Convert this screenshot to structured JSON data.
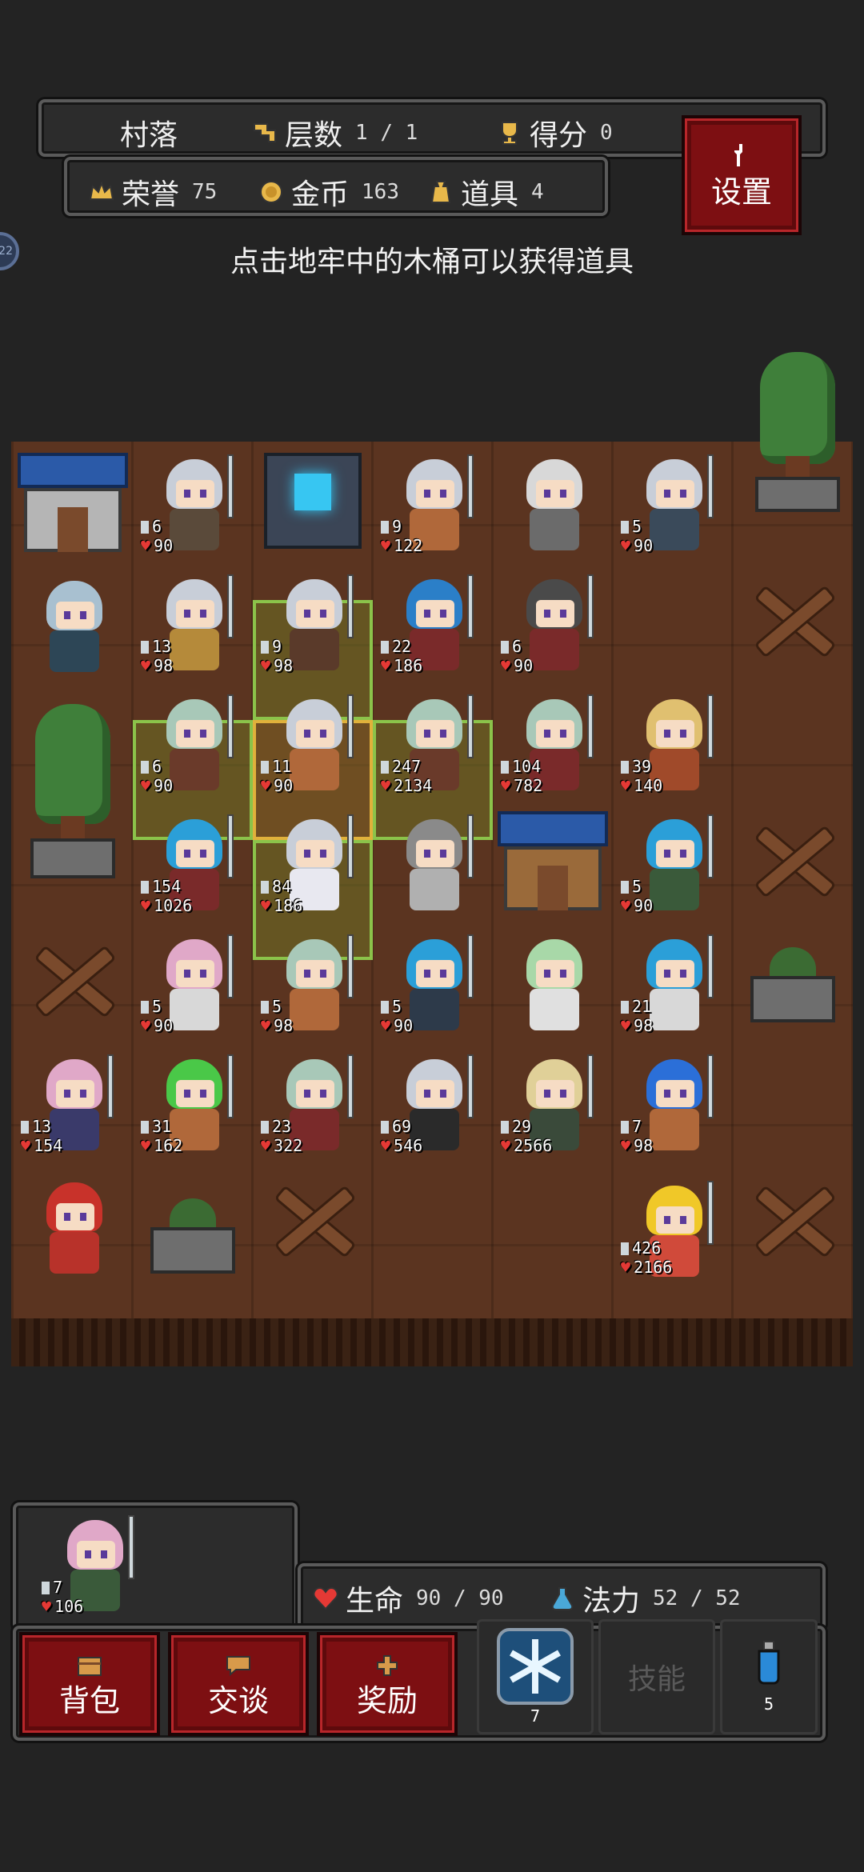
{
  "hud": {
    "location": "村落",
    "floor_label": "层数",
    "floor_value": "1 / 1",
    "score_label": "得分",
    "score_value": "0",
    "honor_label": "荣誉",
    "honor_value": "75",
    "gold_label": "金币",
    "gold_value": "163",
    "items_label": "道具",
    "items_value": "4",
    "settings_label": "设置",
    "side_badge": "22"
  },
  "hint": "点击地牢中的木桶可以获得道具",
  "board": {
    "units": [
      {
        "atk": "6",
        "hp": "90"
      },
      {
        "atk": "9",
        "hp": "122"
      },
      {
        "atk": "5",
        "hp": "90"
      },
      {
        "atk": "13",
        "hp": "98"
      },
      {
        "atk": "9",
        "hp": "98"
      },
      {
        "atk": "22",
        "hp": "186"
      },
      {
        "atk": "6",
        "hp": "90"
      },
      {
        "atk": "6",
        "hp": "90"
      },
      {
        "atk": "11",
        "hp": "90"
      },
      {
        "atk": "247",
        "hp": "2134"
      },
      {
        "atk": "104",
        "hp": "782"
      },
      {
        "atk": "39",
        "hp": "140"
      },
      {
        "atk": "154",
        "hp": "1026"
      },
      {
        "atk": "84",
        "hp": "186"
      },
      {
        "atk": "5",
        "hp": "90"
      },
      {
        "atk": "5",
        "hp": "90"
      },
      {
        "atk": "5",
        "hp": "98"
      },
      {
        "atk": "5",
        "hp": "90"
      },
      {
        "atk": "21",
        "hp": "98"
      },
      {
        "atk": "13",
        "hp": "154"
      },
      {
        "atk": "31",
        "hp": "162"
      },
      {
        "atk": "23",
        "hp": "322"
      },
      {
        "atk": "69",
        "hp": "546"
      },
      {
        "atk": "29",
        "hp": "2566"
      },
      {
        "atk": "7",
        "hp": "98"
      },
      {
        "atk": "426",
        "hp": "2166"
      }
    ]
  },
  "player": {
    "atk": "7",
    "hp": "106",
    "life_label": "生命",
    "life_value": "90 / 90",
    "mana_label": "法力",
    "mana_value": "52 / 52"
  },
  "actions": {
    "bag": "背包",
    "talk": "交谈",
    "reward": "奖励",
    "skill_label": "技能",
    "skill_count": "7",
    "potion_count": "5"
  },
  "colors": {
    "accent_red": "#7d0f12",
    "board_dirt": "#5b3420",
    "highlight_green": "#8bc34a",
    "highlight_yellow": "#e0b13b"
  }
}
